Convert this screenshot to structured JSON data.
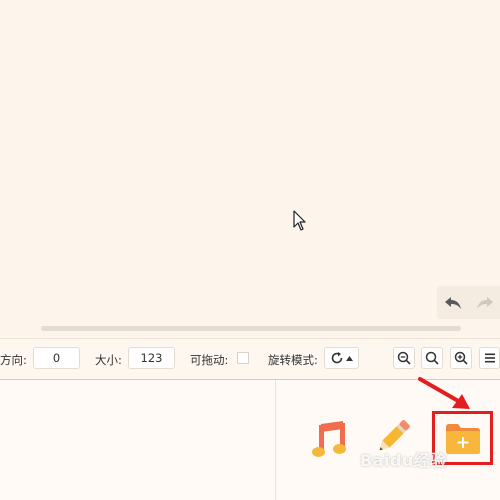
{
  "toolbar": {
    "direction_label": "方向:",
    "direction_value": "0",
    "size_label": "大小:",
    "size_value": "123",
    "draggable_label": "可拖动:",
    "rotate_label": "旋转模式:"
  },
  "icons": {
    "undo": "undo-arrow-icon",
    "redo": "redo-arrow-icon",
    "rotate": "rotate-icon",
    "zoom_out": "zoom-out-icon",
    "zoom_reset": "zoom-reset-icon",
    "zoom_in": "zoom-in-icon",
    "menu": "menu-icon",
    "music": "music-note-icon",
    "pencil": "pencil-icon",
    "folder_add": "folder-add-icon"
  },
  "colors": {
    "background": "#fdf5ec",
    "highlight": "#e41e1e",
    "accent": "#f1c992"
  },
  "watermark": "Baidu经验"
}
